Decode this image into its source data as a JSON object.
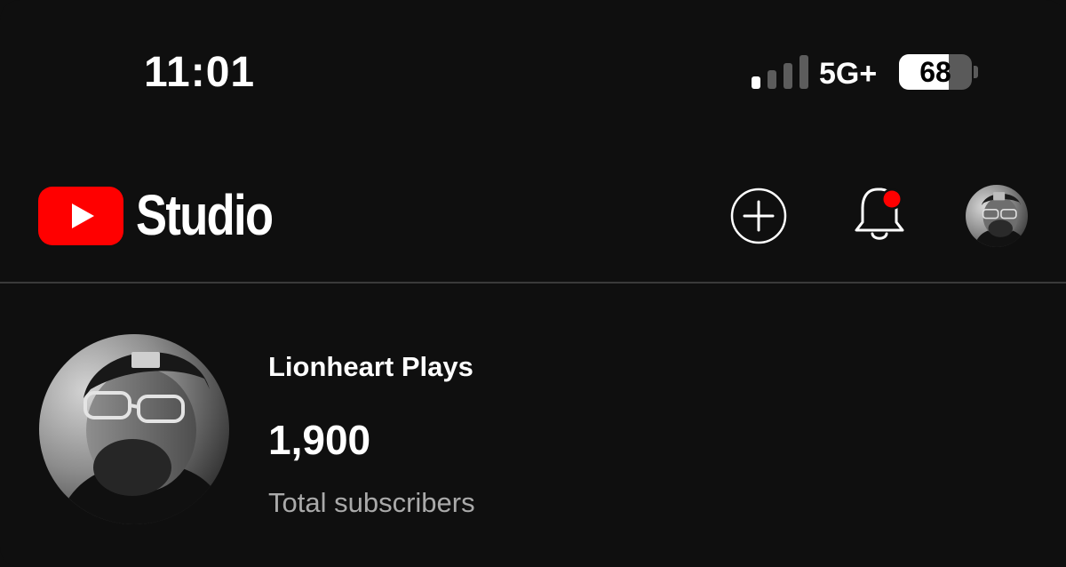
{
  "status_bar": {
    "time": "11:01",
    "network": "5G+",
    "battery_level": "68",
    "battery_fraction": 0.68,
    "signal_bars_total": 4,
    "signal_bars_active": 1
  },
  "header": {
    "brand_name": "Studio",
    "brand_color": "#ff0000",
    "icons": {
      "logo": "youtube-play-logo",
      "create": "plus-circle-icon",
      "notifications": "bell-icon",
      "notification_dot_color": "#ff0000",
      "account": "avatar"
    }
  },
  "channel": {
    "name": "Lionheart Plays",
    "subscriber_count": "1,900",
    "subscriber_label": "Total subscribers"
  }
}
